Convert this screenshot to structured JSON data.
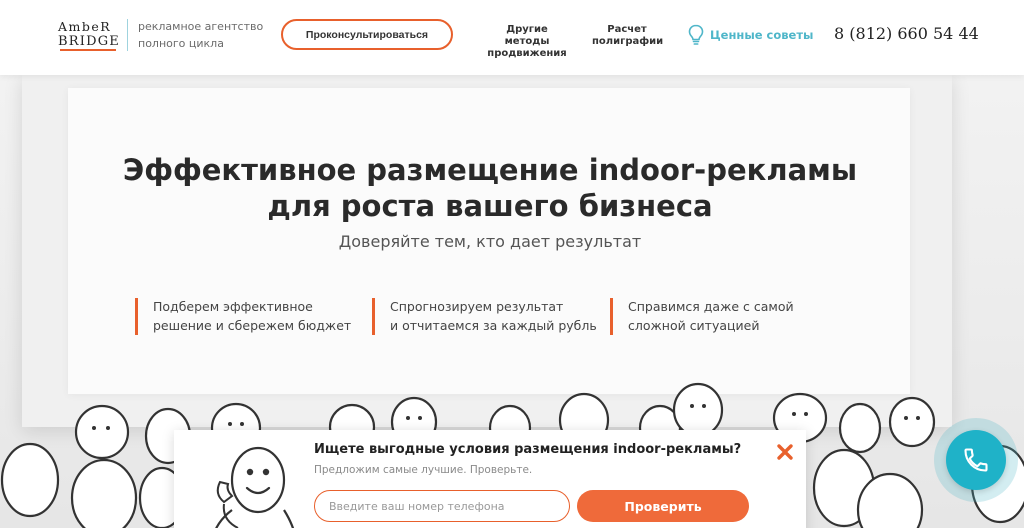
{
  "header": {
    "logo_line1": "AmbeR",
    "logo_line2": "BRIDGE",
    "tagline": "рекламное агентство полного цикла",
    "consult_label": "Проконсультироваться",
    "nav": {
      "other_methods": "Другие методы продвижения",
      "print_calc": "Расчет полиграфии"
    },
    "tips_label": "Ценные советы",
    "phone": "8 (812) 660 54 44"
  },
  "hero": {
    "title_line1": "Эффективное размещение indoor-рекламы",
    "title_line2": "для роста вашего бизнеса",
    "subtitle": "Доверяйте тем, кто дает результат",
    "features": [
      {
        "line1": "Подберем эффективное",
        "line2": "решение и сбережем бюджет"
      },
      {
        "line1": "Спрогнозируем результат",
        "line2": "и отчитаемся за каждый рубль"
      },
      {
        "line1": "Справимся даже с самой",
        "line2": "сложной ситуацией"
      }
    ]
  },
  "popup": {
    "title": "Ищете выгодные условия размещения indoor-рекламы?",
    "subtitle": "Предложим самые лучшие. Проверьте.",
    "phone_placeholder": "Введите ваш номер телефона",
    "phone_value": "",
    "submit_label": "Проверить"
  },
  "colors": {
    "accent": "#e8602c",
    "button": "#ef6a3a",
    "teal": "#1fb2c8",
    "tips": "#4fb6c9"
  },
  "icons": {
    "tips": "lightbulb-icon",
    "close": "close-icon",
    "call": "phone-handset-icon"
  }
}
